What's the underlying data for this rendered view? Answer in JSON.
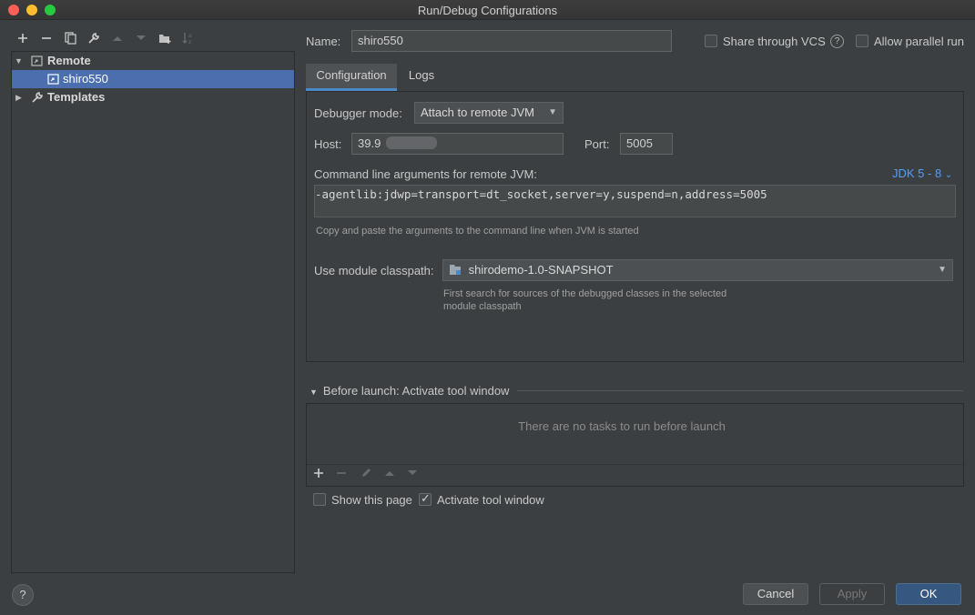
{
  "window": {
    "title": "Run/Debug Configurations"
  },
  "left_toolbar": {
    "icons": [
      "add-icon",
      "remove-icon",
      "copy-icon",
      "wrench-icon",
      "move-up-icon",
      "move-down-icon",
      "new-folder-icon",
      "sort-icon"
    ]
  },
  "tree": {
    "remote_label": "Remote",
    "config_label": "shiro550",
    "templates_label": "Templates"
  },
  "header": {
    "name_label": "Name:",
    "name_value": "shiro550",
    "share_vcs_label": "Share through VCS",
    "allow_parallel_label": "Allow parallel run"
  },
  "tabs": [
    {
      "label": "Configuration"
    },
    {
      "label": "Logs"
    }
  ],
  "config": {
    "debugger_mode_label": "Debugger mode:",
    "debugger_mode_value": "Attach to remote JVM",
    "host_label": "Host:",
    "host_value": "39.9",
    "port_label": "Port:",
    "port_value": "5005",
    "cmd_label": "Command line arguments for remote JVM:",
    "jdk_link": "JDK 5 - 8",
    "cmd_value": "-agentlib:jdwp=transport=dt_socket,server=y,suspend=n,address=5005",
    "cmd_hint": "Copy and paste the arguments to the command line when JVM is started",
    "module_label": "Use module classpath:",
    "module_value": "shirodemo-1.0-SNAPSHOT",
    "module_hint_1": "First search for sources of the debugged classes in the selected",
    "module_hint_2": "module classpath"
  },
  "before_launch": {
    "title": "Before launch: Activate tool window",
    "empty_text": "There are no tasks to run before launch",
    "show_page_label": "Show this page",
    "activate_label": "Activate tool window"
  },
  "buttons": {
    "cancel": "Cancel",
    "apply": "Apply",
    "ok": "OK"
  },
  "colors": {
    "selection": "#4b6eaf",
    "link": "#589df6",
    "primary_button": "#365880"
  }
}
